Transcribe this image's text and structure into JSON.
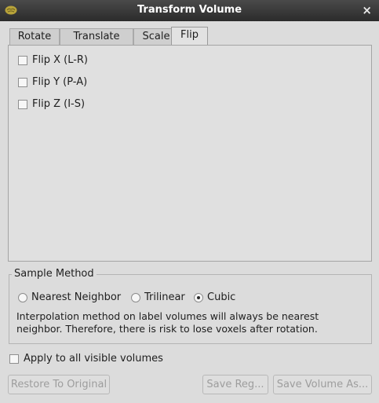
{
  "window": {
    "title": "Transform Volume",
    "close_glyph": "×"
  },
  "tabs": [
    {
      "label": "Rotate",
      "active": false
    },
    {
      "label": "Translate",
      "active": false
    },
    {
      "label": "Scale",
      "active": false
    },
    {
      "label": "Flip",
      "active": true
    }
  ],
  "flip": {
    "options": [
      {
        "label": "Flip X (L-R)",
        "checked": false
      },
      {
        "label": "Flip Y (P-A)",
        "checked": false
      },
      {
        "label": "Flip Z (I-S)",
        "checked": false
      }
    ]
  },
  "sample_method": {
    "title": "Sample Method",
    "options": [
      {
        "label": "Nearest Neighbor",
        "selected": false
      },
      {
        "label": "Trilinear",
        "selected": false
      },
      {
        "label": "Cubic",
        "selected": true
      }
    ],
    "note_line1": "Interpolation method on label volumes will always be nearest",
    "note_line2": "neighbor. Therefore, there is risk to lose voxels after rotation."
  },
  "apply_all": {
    "label": "Apply to all visible volumes",
    "checked": false
  },
  "buttons": {
    "restore": "Restore To Original",
    "save_reg": "Save Reg...",
    "save_volume": "Save Volume As..."
  },
  "colors": {
    "titlebar": "#333333",
    "window_bg": "#dcdcdc",
    "disabled_text": "#9d9d9d"
  }
}
